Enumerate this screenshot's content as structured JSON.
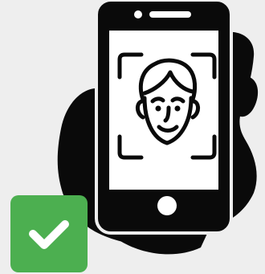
{
  "illustration": {
    "subject": "hand-holding-phone-face-scan",
    "icons": [
      "hand-icon",
      "smartphone-icon",
      "face-scan-frame-icon",
      "face-icon",
      "checkmark-icon"
    ],
    "colors": {
      "background": "#eeeeee",
      "silhouette": "#0a0a0a",
      "screen": "#ffffff",
      "check_badge": "#4caf50",
      "check_mark": "#ffffff"
    }
  }
}
